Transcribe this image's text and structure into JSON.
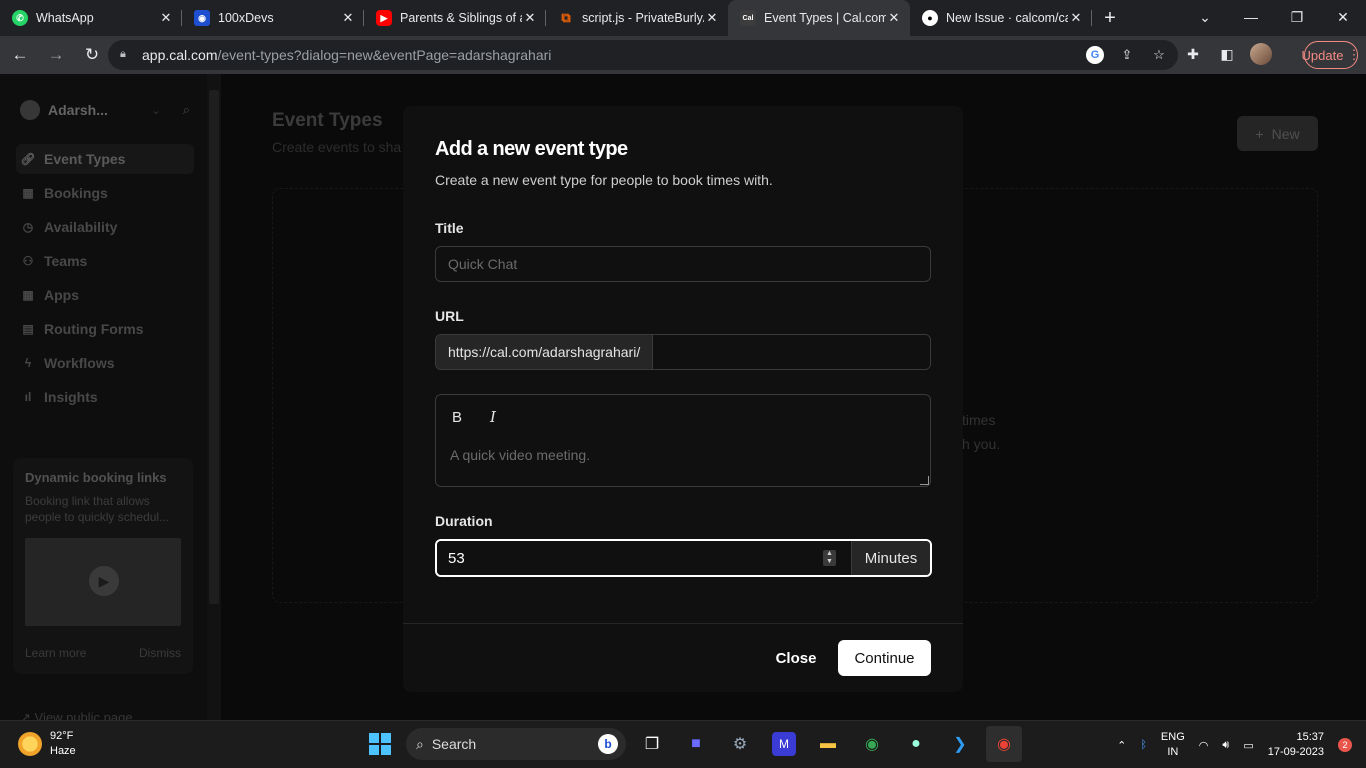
{
  "browser": {
    "tabs": [
      {
        "label": "WhatsApp",
        "icon": "whatsapp-icon"
      },
      {
        "label": "100xDevs",
        "icon": "100xdevs-icon"
      },
      {
        "label": "Parents & Siblings of a",
        "icon": "youtube-icon"
      },
      {
        "label": "script.js - PrivateBurlyA",
        "icon": "replit-icon"
      },
      {
        "label": "Event Types | Cal.com",
        "icon": "cal-icon"
      },
      {
        "label": "New Issue · calcom/ca",
        "icon": "github-icon"
      }
    ],
    "url_host": "app.cal.com",
    "url_path": "/event-types?dialog=new&eventPage=adarshagrahari",
    "update_label": "Update"
  },
  "sidebar": {
    "user_name": "Adarsh...",
    "items": [
      {
        "label": "Event Types",
        "icon": "link-icon"
      },
      {
        "label": "Bookings",
        "icon": "calendar-icon"
      },
      {
        "label": "Availability",
        "icon": "clock-icon"
      },
      {
        "label": "Teams",
        "icon": "users-icon"
      },
      {
        "label": "Apps",
        "icon": "grid-icon"
      },
      {
        "label": "Routing Forms",
        "icon": "file-icon"
      },
      {
        "label": "Workflows",
        "icon": "zap-icon"
      },
      {
        "label": "Insights",
        "icon": "bar-chart-icon"
      }
    ],
    "promo": {
      "title": "Dynamic booking links",
      "description": "Booking link that allows people to quickly schedul...",
      "learn_more": "Learn more",
      "dismiss": "Dismiss"
    },
    "view_public_page": "View public page"
  },
  "main": {
    "title": "Event Types",
    "subtitle": "Create events to sha",
    "new_button": "New",
    "empty_text_line1": "times",
    "empty_text_line2": "h you."
  },
  "modal": {
    "title": "Add a new event type",
    "subtitle": "Create a new event type for people to book times with.",
    "title_label": "Title",
    "title_placeholder": "Quick Chat",
    "url_label": "URL",
    "url_prefix": "https://cal.com/adarshagrahari/",
    "description_placeholder": "A quick video meeting.",
    "bold_label": "B",
    "italic_label": "I",
    "duration_label": "Duration",
    "duration_value": "53",
    "duration_suffix": "Minutes",
    "close_label": "Close",
    "continue_label": "Continue"
  },
  "taskbar": {
    "temperature": "92°F",
    "weather": "Haze",
    "search_label": "Search",
    "language_line1": "ENG",
    "language_line2": "IN",
    "time": "15:37",
    "date": "17-09-2023",
    "notification_count": "2"
  }
}
